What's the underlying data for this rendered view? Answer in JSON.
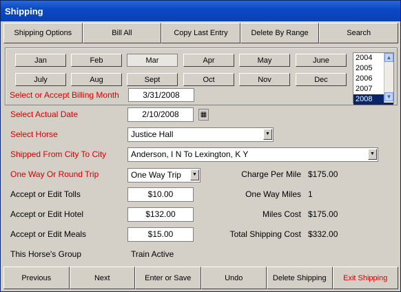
{
  "title": "Shipping",
  "toolbar": [
    "Shipping Options",
    "Bill All",
    "Copy Last Entry",
    "Delete By Range",
    "Search"
  ],
  "months": [
    "Jan",
    "Feb",
    "Mar",
    "Apr",
    "May",
    "June",
    "July",
    "Aug",
    "Sept",
    "Oct",
    "Nov",
    "Dec"
  ],
  "selected_month": "Mar",
  "years": [
    "2004",
    "2005",
    "2006",
    "2007",
    "2008"
  ],
  "selected_year": "2008",
  "billing_month": {
    "label": "Select or Accept Billing Month",
    "value": "3/31/2008"
  },
  "actual_date": {
    "label": "Select Actual Date",
    "value": "2/10/2008"
  },
  "horse": {
    "label": "Select Horse",
    "value": "Justice Hall"
  },
  "route": {
    "label": "Shipped From City To City",
    "value": "Anderson, I N To Lexington, K Y"
  },
  "trip": {
    "label": "One Way Or Round Trip",
    "value": "One Way Trip"
  },
  "tolls": {
    "label": "Accept or Edit Tolls",
    "value": "$10.00"
  },
  "hotel": {
    "label": "Accept or Edit Hotel",
    "value": "$132.00"
  },
  "meals": {
    "label": "Accept or Edit Meals",
    "value": "$15.00"
  },
  "group": {
    "label": "This Horse's Group",
    "value": "Train Active"
  },
  "summary": {
    "charge_label": "Charge Per Mile",
    "charge_value": "$175.00",
    "miles_label": "One Way Miles",
    "miles_value": "1",
    "miles_cost_label": "Miles Cost",
    "miles_cost_value": "$175.00",
    "total_label": "Total Shipping Cost",
    "total_value": "$332.00"
  },
  "bottom": [
    "Previous",
    "Next",
    "Enter or Save",
    "Undo",
    "Delete Shipping",
    "Exit Shipping"
  ],
  "colors": {
    "label_red": "#d40000",
    "title_blue": "#0b4ac4"
  }
}
